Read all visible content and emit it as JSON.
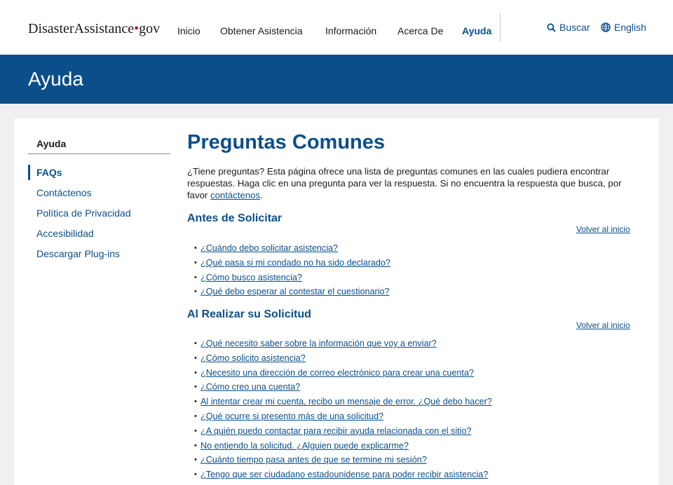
{
  "header": {
    "logo": {
      "part1": "Disaster",
      "part2": "Assistance",
      "dot": "•",
      "part3": "gov"
    },
    "nav": [
      {
        "label": "Inicio"
      },
      {
        "label": "Obtener Asistencia"
      },
      {
        "label": "Información"
      },
      {
        "label": "Acerca De"
      },
      {
        "label": "Ayuda",
        "active": true
      }
    ],
    "search_label": "Buscar",
    "language_label": "English"
  },
  "banner": {
    "title": "Ayuda"
  },
  "sidebar": {
    "title": "Ayuda",
    "items": [
      {
        "label": "FAQs",
        "active": true
      },
      {
        "label": "Contáctenos"
      },
      {
        "label": "Política de Privacidad"
      },
      {
        "label": "Accesibilidad"
      },
      {
        "label": "Descargar Plug-ins"
      }
    ]
  },
  "main": {
    "title": "Preguntas Comunes",
    "intro_text": "¿Tiene preguntas? Esta página ofrece una lista de preguntas comunes en las cuales pudiera encontrar respuestas. Haga clic en una pregunta para ver la respuesta. Si no encuentra la respuesta que busca, por favor ",
    "intro_link": "contáctenos",
    "intro_end": ".",
    "back_label": "Volver al inicio",
    "sections": [
      {
        "title": "Antes de Solicitar",
        "questions": [
          "¿Cuándo debo solicitar asistencia?",
          "¿Qué pasa si mi condado no ha sido declarado?",
          "¿Cómo busco asistencia?",
          "¿Qué debo esperar al contestar el cuestionario?"
        ]
      },
      {
        "title": "Al Realizar su Solicitud",
        "questions": [
          "¿Qué necesito saber sobre la información que voy a enviar?",
          "¿Cómo solicito asistencia?",
          "¿Necesito una dirección de correo electrónico para crear una cuenta?",
          "¿Cómo creo una cuenta?",
          "Al intentar crear mi cuenta, recibo un mensaje de error. ¿Qué debo hacer?",
          "¿Qué ocurre si presento más de una solicitud?",
          "¿A quién puedo contactar para recibir ayuda relacionada con el sitio?",
          "No entiendo la solicitud. ¿Alguien puede explicarme?",
          "¿Cuánto tiempo pasa antes de que se termine mi sesión?",
          "¿Tengo que ser ciudadano estadounidense para poder recibir asistencia?"
        ]
      }
    ]
  },
  "colors": {
    "brand_blue": "#0b4f8a",
    "logo_dot": "#c8102e"
  }
}
